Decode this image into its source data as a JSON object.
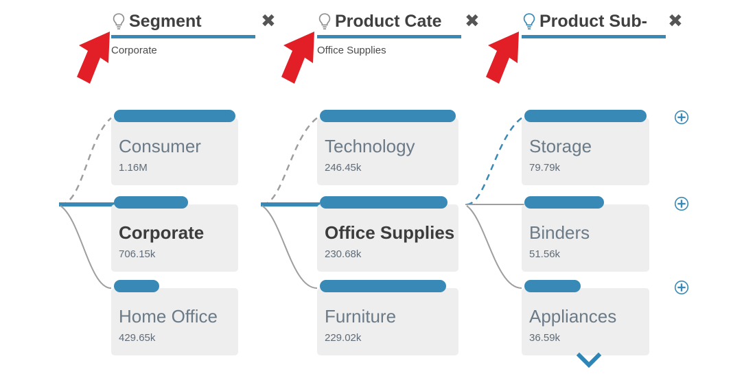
{
  "columns": [
    {
      "header": {
        "label": "Segment",
        "value": "Corporate",
        "icon": "lightbulb-icon",
        "icon_state": "inactive",
        "close_icon": "close-icon",
        "close_label": "✖"
      },
      "cards": [
        {
          "title": "Consumer",
          "value": "1.16M",
          "bar_pct": 100,
          "selected": false,
          "expandable": false
        },
        {
          "title": "Corporate",
          "value": "706.15k",
          "bar_pct": 61,
          "selected": true,
          "expandable": false
        },
        {
          "title": "Home Office",
          "value": "429.65k",
          "bar_pct": 37,
          "selected": false,
          "expandable": false
        }
      ]
    },
    {
      "header": {
        "label": "Product Cate",
        "value": "Office Supplies",
        "icon": "lightbulb-icon",
        "icon_state": "inactive",
        "close_icon": "close-icon",
        "close_label": "✖"
      },
      "cards": [
        {
          "title": "Technology",
          "value": "246.45k",
          "bar_pct": 100,
          "selected": false,
          "expandable": false
        },
        {
          "title": "Office Supplies",
          "value": "230.68k",
          "bar_pct": 94,
          "selected": true,
          "expandable": false
        },
        {
          "title": "Furniture",
          "value": "229.02k",
          "bar_pct": 93,
          "selected": false,
          "expandable": false
        }
      ]
    },
    {
      "header": {
        "label": "Product Sub-",
        "value": "",
        "icon": "lightbulb-icon",
        "icon_state": "active",
        "close_icon": "close-icon",
        "close_label": "✖"
      },
      "cards": [
        {
          "title": "Storage",
          "value": "79.79k",
          "bar_pct": 100,
          "selected": false,
          "expandable": true,
          "expand_icon": "plus-circle-icon"
        },
        {
          "title": "Binders",
          "value": "51.56k",
          "bar_pct": 65,
          "selected": false,
          "expandable": true,
          "expand_icon": "plus-circle-icon"
        },
        {
          "title": "Appliances",
          "value": "36.59k",
          "bar_pct": 46,
          "selected": false,
          "expandable": true,
          "expand_icon": "plus-circle-icon"
        }
      ],
      "more_icon": "chevron-down-icon"
    }
  ],
  "annotations": {
    "arrows": [
      {
        "name": "arrow-segment",
        "color": "#e21f26"
      },
      {
        "name": "arrow-product-category",
        "color": "#e21f26"
      },
      {
        "name": "arrow-product-subcategory",
        "color": "#e21f26"
      }
    ]
  },
  "colors": {
    "accent_blue": "#3889b5",
    "card_bg": "#eeeeee",
    "connector_gray": "#9e9e9e",
    "arrow_red": "#e21f26"
  }
}
